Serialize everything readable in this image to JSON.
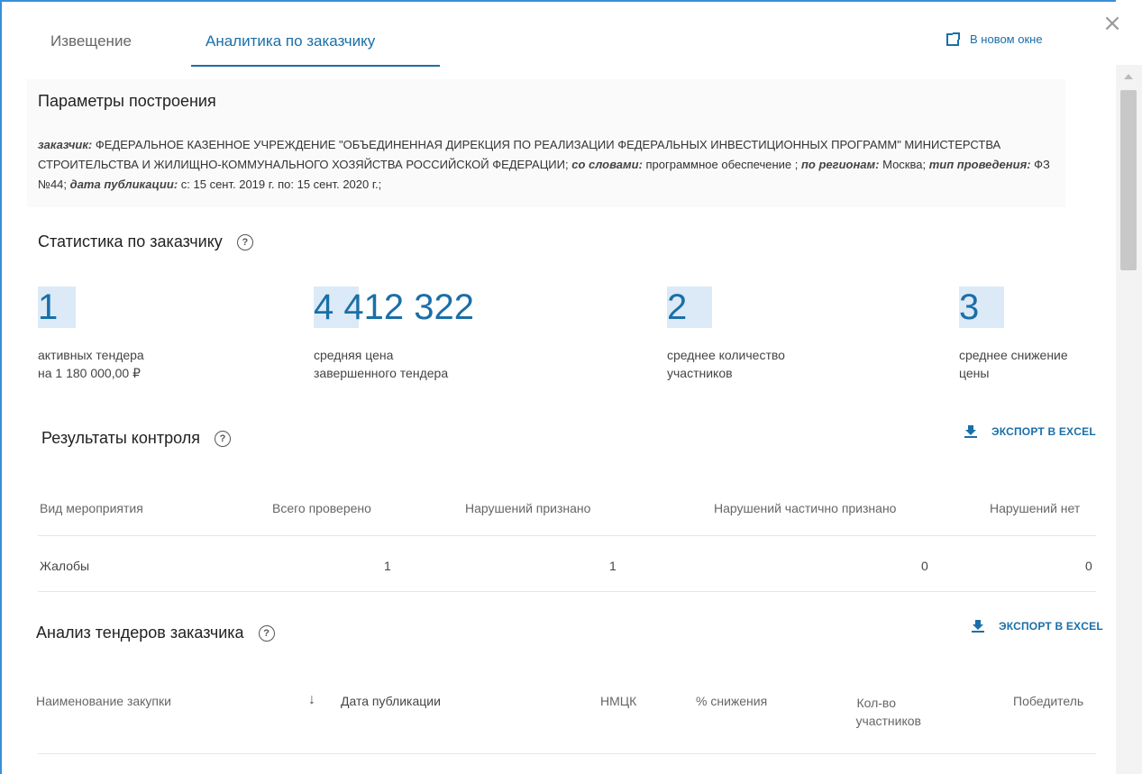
{
  "tabs": {
    "notice": "Извещение",
    "analytics": "Аналитика по заказчику"
  },
  "header": {
    "new_window": "В новом окне",
    "close": "×"
  },
  "params": {
    "title": "Параметры построения",
    "customer_label": "заказчик:",
    "customer_value": " ФЕДЕРАЛЬНОЕ КАЗЕННОЕ УЧРЕЖДЕНИЕ \"ОБЪЕДИНЕННАЯ ДИРЕКЦИЯ ПО РЕАЛИЗАЦИИ ФЕДЕРАЛЬНЫХ ИНВЕСТИЦИОННЫХ ПРОГРАММ\" МИНИСТЕРСТВА СТРОИТЕЛЬСТВА И ЖИЛИЩНО-КОММУНАЛЬНОГО ХОЗЯЙСТВА РОССИЙСКОЙ ФЕДЕРАЦИИ;",
    "words_label": "со словами:",
    "words_value": " программное обеспечение ;",
    "regions_label": "по регионам:",
    "regions_value": " Москва;",
    "type_label": "тип проведения:",
    "type_value": " ФЗ №44;",
    "date_label": "дата публикации:",
    "date_value": " с: 15 сент. 2019 г. по: 15 сент. 2020 г.;"
  },
  "stats": {
    "title": "Статистика по заказчику",
    "help": "?",
    "items": [
      {
        "value": "1",
        "label1": "активных тендера",
        "label2": "на 1 180 000,00 ₽"
      },
      {
        "value": "4 412 322",
        "label1": "средняя цена",
        "label2": "завершенного тендера"
      },
      {
        "value": "2",
        "label1": "среднее количество",
        "label2": "участников"
      },
      {
        "value": "3",
        "label1": "среднее снижение",
        "label2": "цены"
      }
    ]
  },
  "control": {
    "title": "Результаты контроля",
    "help": "?",
    "export": "ЭКСПОРТ В EXCEL",
    "columns": [
      "Вид мероприятия",
      "Всего проверено",
      "Нарушений признано",
      "Нарушений частично признано",
      "Нарушений нет"
    ],
    "rows": [
      [
        "Жалобы",
        "1",
        "1",
        "0",
        "0"
      ]
    ]
  },
  "analysis": {
    "title": "Анализ тендеров заказчика",
    "help": "?",
    "export": "ЭКСПОРТ В EXCEL",
    "sort_icon": "↓",
    "columns": {
      "name": "Наименование закупки",
      "date": "Дата публикации",
      "nmck": "НМЦК",
      "reduction": "% снижения",
      "participants1": "Кол-во",
      "participants2": "участников",
      "winner": "Победитель"
    }
  }
}
